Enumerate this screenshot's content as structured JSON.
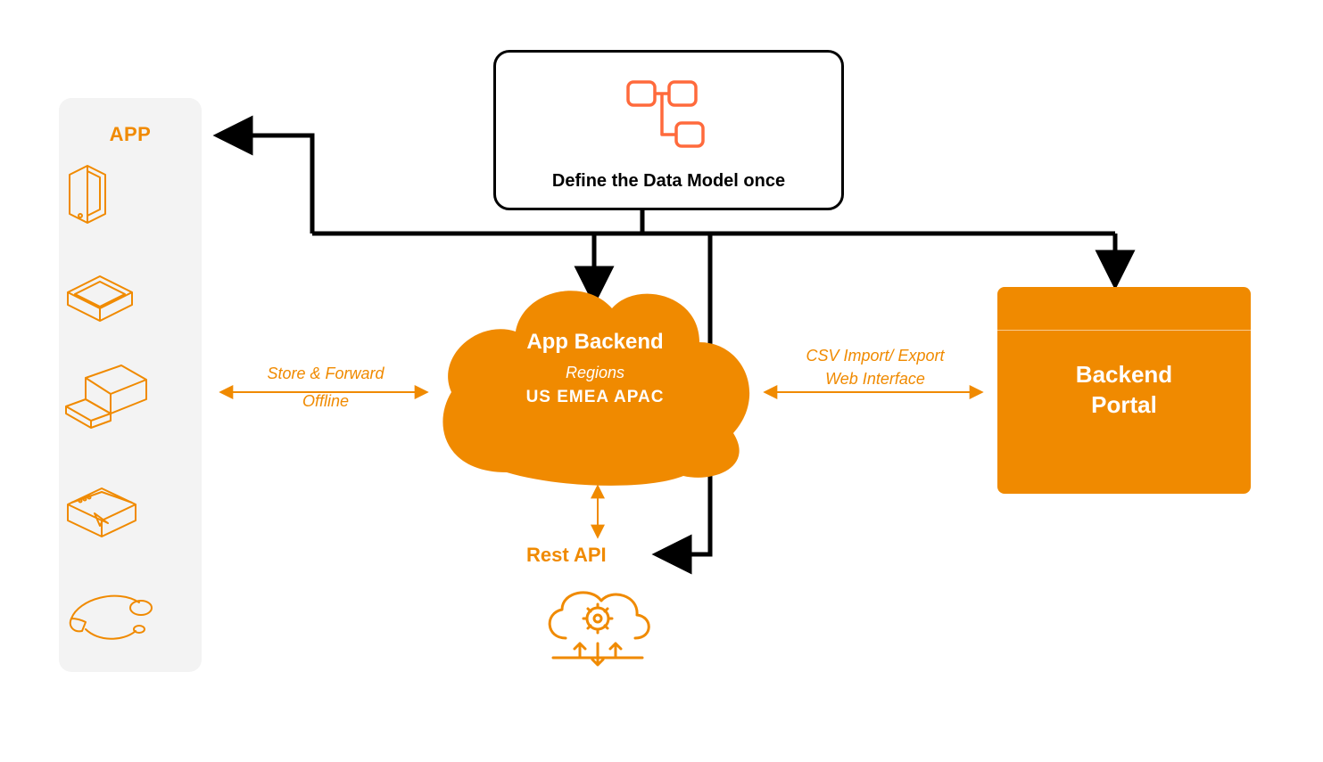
{
  "app": {
    "title": "APP"
  },
  "datamodel": {
    "label": "Define the Data Model once"
  },
  "cloud": {
    "title": "App Backend",
    "subtitle": "Regions",
    "regions": "US  EMEA  APAC"
  },
  "portal": {
    "line1": "Backend",
    "line2": "Portal"
  },
  "connectors": {
    "left1": "Store & Forward",
    "left2": "Offline",
    "right1": "CSV Import/ Export",
    "right2": "Web Interface"
  },
  "rest": {
    "label": "Rest API"
  },
  "colors": {
    "accent": "#f08a00"
  }
}
